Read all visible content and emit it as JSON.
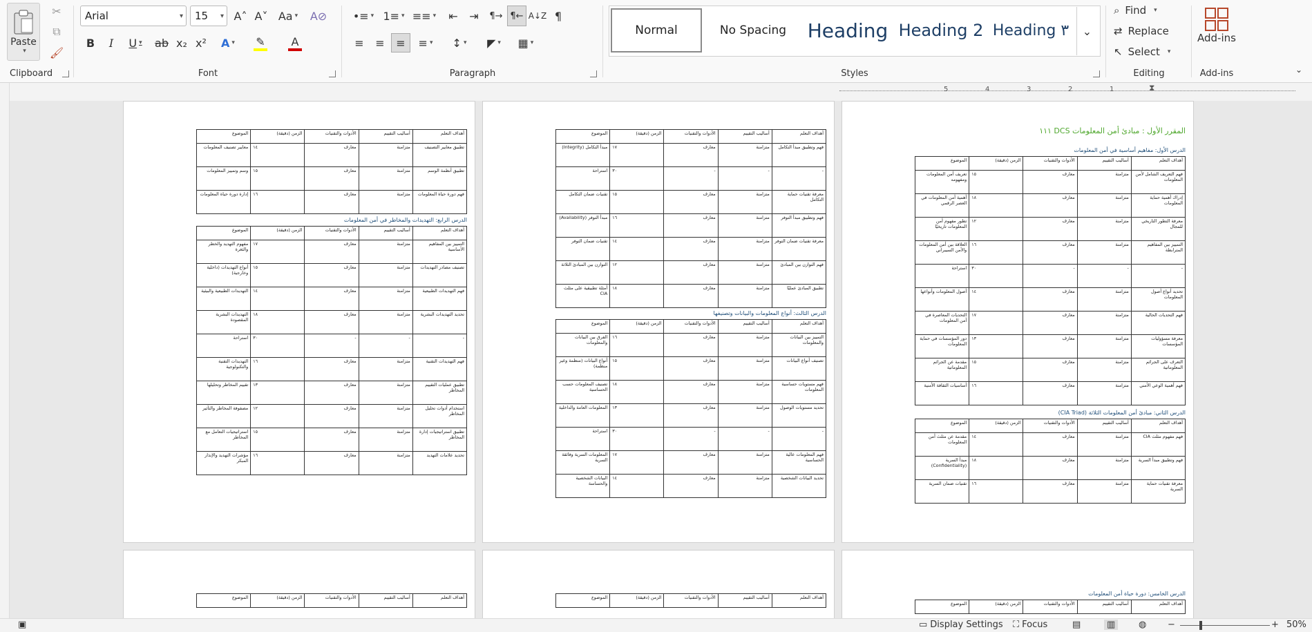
{
  "ribbon": {
    "clipboard": {
      "label": "Clipboard",
      "paste": "Paste",
      "cut_icon": "scissors-icon",
      "copy_icon": "copy-icon",
      "format_painter_icon": "brush-icon"
    },
    "font": {
      "label": "Font",
      "name": "Arial",
      "size": "15",
      "grow": "A˄",
      "shrink": "A˅",
      "case": "Aa",
      "clear": "A⊘",
      "bold": "B",
      "italic": "I",
      "underline": "U",
      "strike": "ab",
      "sub": "x₂",
      "sup": "x²",
      "effects": "A",
      "highlight": "✎",
      "color": "A",
      "highlight_color": "#ffff00",
      "font_color": "#d00000"
    },
    "paragraph": {
      "label": "Paragraph",
      "bullets": "•≡",
      "numbering": "1≡",
      "multilevel": "≡≡",
      "decrease": "⇤",
      "increase": "⇥",
      "ltr": "¶→",
      "rtl": "¶←",
      "sort": "A↓Z",
      "pilcrow": "¶",
      "align_left": "≡",
      "center": "≡",
      "align_right": "≡",
      "justify": "≡",
      "spacing": "↕",
      "shading": "◤",
      "borders": "▦"
    },
    "styles": {
      "label": "Styles",
      "items": [
        "Normal",
        "No Spacing",
        "Heading",
        "Heading 2",
        "Heading ٣"
      ]
    },
    "editing": {
      "label": "Editing",
      "find": "Find",
      "replace": "Replace",
      "select": "Select"
    },
    "addins": {
      "label": "Add-ins",
      "button": "Add-ins"
    },
    "accent": "#b7472a"
  },
  "ruler": {
    "numbers": [
      "1",
      "2",
      "3",
      "4",
      "5"
    ]
  },
  "pages": {
    "p1": {
      "title": "المقرر الأول : مبادئ أمن المعلومات DCS ١١١",
      "lesson1": "الدرس الأول: مفاهيم أساسية في أمن المعلومات",
      "lesson2": "الدرس الثاني: مبادئ أمن المعلومات الثلاثة (CIA Triad)",
      "lesson5": "الدرس الخامس: دورة حياة أمن المعلومات"
    },
    "p2": {
      "lesson3": "الدرس الثالث: أنواع المعلومات والبيانات وتصنيفها"
    },
    "p3": {
      "lesson4": "الدرس الرابع: التهديدات والمخاطر في أمن المعلومات"
    }
  },
  "table_headers": [
    "أهداف التعلم",
    "أساليب التقييم",
    "الأدوات والتقنيات",
    "الزمن (دقيقة)",
    "الموضوع"
  ],
  "tables": {
    "t1": [
      [
        "فهم التعريف الشامل لأمن المعلومات",
        "متزامنة",
        "معارف",
        "١٥",
        "تعريف أمن المعلومات ومفهومه"
      ],
      [
        "إدراك أهمية حماية المعلومات",
        "متزامنة",
        "معارف",
        "١٨",
        "أهمية أمن المعلومات في العصر الرقمي"
      ],
      [
        "معرفة التطور التاريخي للمجال",
        "متزامنة",
        "معارف",
        "١٢",
        "تطور مفهوم أمن المعلومات تاريخيًا"
      ],
      [
        "التمييز بين المفاهيم المترابطة",
        "متزامنة",
        "معارف",
        "١٦",
        "العلاقة بين أمن المعلومات والأمن السيبراني"
      ],
      [
        "-",
        "-",
        "-",
        "٣٠",
        "استراحة"
      ],
      [
        "تحديد أنواع أصول المعلومات",
        "متزامنة",
        "معارف",
        "١٤",
        "أصول المعلومات وأنواعها"
      ],
      [
        "فهم التحديات الحالية",
        "متزامنة",
        "معارف",
        "١٧",
        "التحديات المعاصرة في أمن المعلومات"
      ],
      [
        "معرفة مسؤوليات المؤسسات",
        "متزامنة",
        "معارف",
        "١٣",
        "دور المؤسسات في حماية المعلومات"
      ],
      [
        "التعرف على الجرائم المعلوماتية",
        "متزامنة",
        "معارف",
        "١٥",
        "مقدمة عن الجرائم المعلوماتية"
      ],
      [
        "فهم أهمية الوعي الأمني",
        "متزامنة",
        "معارف",
        "١٦",
        "أساسيات الثقافة الأمنية"
      ]
    ],
    "t2": [
      [
        "فهم مفهوم مثلث CIA",
        "متزامنة",
        "معارف",
        "١٤",
        "مقدمة عن مثلث أمن المعلومات"
      ],
      [
        "فهم وتطبيق مبدأ السرية",
        "متزامنة",
        "معارف",
        "١٨",
        "مبدأ السرية (Confidentiality)"
      ],
      [
        "معرفة تقنيات حماية السرية",
        "متزامنة",
        "معارف",
        "١٦",
        "تقنيات ضمان السرية"
      ]
    ],
    "t3": [
      [
        "فهم وتطبيق مبدأ التكامل",
        "متزامنة",
        "معارف",
        "١٧",
        "مبدأ التكامل (Integrity)"
      ],
      [
        "-",
        "-",
        "-",
        "٣٠",
        "استراحة"
      ],
      [
        "معرفة تقنيات حماية التكامل",
        "متزامنة",
        "معارف",
        "١٥",
        "تقنيات ضمان التكامل"
      ],
      [
        "فهم وتطبيق مبدأ التوفر",
        "متزامنة",
        "معارف",
        "١٦",
        "مبدأ التوفر (Availability)"
      ],
      [
        "معرفة تقنيات ضمان التوفر",
        "متزامنة",
        "معارف",
        "١٤",
        "تقنيات ضمان التوفر"
      ],
      [
        "فهم التوازن بين المبادئ",
        "متزامنة",
        "معارف",
        "١٢",
        "التوازن بين المبادئ الثلاثة"
      ],
      [
        "تطبيق المبادئ عمليًا",
        "متزامنة",
        "معارف",
        "١٨",
        "أمثلة تطبيقية على مثلث CIA"
      ]
    ],
    "t4": [
      [
        "التمييز بين البيانات والمعلومات",
        "متزامنة",
        "معارف",
        "١٦",
        "الفرق بين البيانات والمعلومات"
      ],
      [
        "تصنيف أنواع البيانات",
        "متزامنة",
        "معارف",
        "١٥",
        "أنواع البيانات (منظمة وغير منظمة)"
      ],
      [
        "فهم مستويات حساسية المعلومات",
        "متزامنة",
        "معارف",
        "١٨",
        "تصنيف المعلومات حسب الحساسية"
      ],
      [
        "تحديد مستويات الوصول",
        "متزامنة",
        "معارف",
        "١٣",
        "المعلومات العامة والداخلية"
      ],
      [
        "-",
        "-",
        "-",
        "٣٠",
        "استراحة"
      ],
      [
        "فهم المعلومات عالية الحساسية",
        "متزامنة",
        "معارف",
        "١٧",
        "المعلومات السرية وفائقة السرية"
      ],
      [
        "تحديد البيانات الشخصية",
        "متزامنة",
        "معارف",
        "١٤",
        "البيانات الشخصية والحساسة"
      ]
    ],
    "t5": [
      [
        "تطبيق معايير التصنيف",
        "متزامنة",
        "معارف",
        "١٤",
        "معايير تصنيف المعلومات"
      ],
      [
        "تطبيق أنظمة الوسم",
        "متزامنة",
        "معارف",
        "١٥",
        "وسم وتمييز المعلومات"
      ],
      [
        "فهم دورة حياة المعلومات",
        "متزامنة",
        "معارف",
        "١٦",
        "إدارة دورة حياة المعلومات"
      ]
    ],
    "t6": [
      [
        "التمييز بين المفاهيم الأساسية",
        "متزامنة",
        "معارف",
        "١٧",
        "مفهوم التهديد والخطر والثغرة"
      ],
      [
        "تصنيف مصادر التهديدات",
        "متزامنة",
        "معارف",
        "١٥",
        "أنواع التهديدات (داخلية وخارجية)"
      ],
      [
        "فهم التهديدات الطبيعية",
        "متزامنة",
        "معارف",
        "١٤",
        "التهديدات الطبيعية والبيئية"
      ],
      [
        "تحديد التهديدات البشرية",
        "متزامنة",
        "معارف",
        "١٨",
        "التهديدات البشرية المقصودة"
      ],
      [
        "-",
        "-",
        "-",
        "٣٠",
        "استراحة"
      ],
      [
        "فهم التهديدات التقنية",
        "متزامنة",
        "معارف",
        "١٦",
        "التهديدات التقنية والتكنولوجية"
      ],
      [
        "تطبيق عمليات التقييم المخاطر",
        "متزامنة",
        "معارف",
        "١٣",
        "تقييم المخاطر وتحليلها"
      ],
      [
        "استخدام أدوات تحليل المخاطر",
        "متزامنة",
        "معارف",
        "١٢",
        "مصفوفة المخاطر والتأثير"
      ],
      [
        "تطبيق استراتيجيات إدارة المخاطر",
        "متزامنة",
        "معارف",
        "١٥",
        "استراتيجيات التعامل مع المخاطر"
      ],
      [
        "تحديد علامات التهديد",
        "متزامنة",
        "معارف",
        "١٦",
        "مؤشرات التهديد والإنذار المبكر"
      ]
    ]
  },
  "status": {
    "display_settings": "Display Settings",
    "focus": "Focus",
    "zoom": "50%"
  }
}
